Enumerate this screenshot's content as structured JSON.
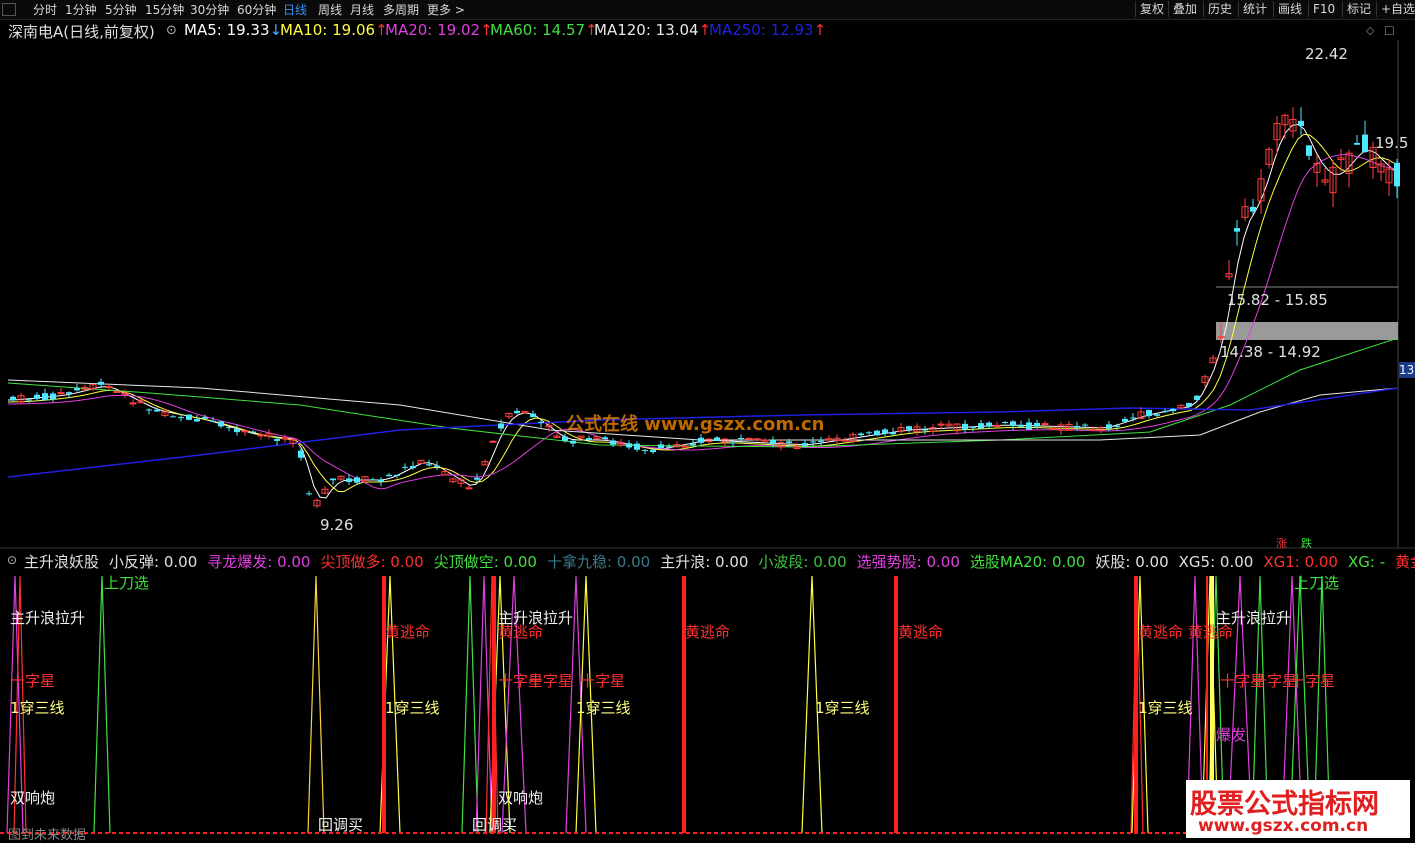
{
  "toolbar": {
    "timeframes": [
      "分时",
      "1分钟",
      "5分钟",
      "15分钟",
      "30分钟",
      "60分钟",
      "日线",
      "周线",
      "月线",
      "多周期",
      "更多 >"
    ],
    "active": "日线",
    "right_buttons": [
      "复权",
      "叠加",
      "历史",
      "统计",
      "画线",
      "F10",
      "标记",
      "+自选"
    ]
  },
  "main": {
    "title": "深南电A(日线,前复权)",
    "ma": [
      {
        "label": "MA5: 19.33",
        "arrow": "↓",
        "color": "#ffffff"
      },
      {
        "label": "MA10: 19.06",
        "arrow": "↑",
        "color": "#ffff40"
      },
      {
        "label": "MA20: 19.02",
        "arrow": "↑",
        "color": "#e040e0"
      },
      {
        "label": "MA60: 14.57",
        "arrow": "↑",
        "color": "#40e040"
      },
      {
        "label": "MA120: 13.04",
        "arrow": "↑",
        "color": "#e8e8e8"
      },
      {
        "label": "MA250: 12.93",
        "arrow": "↑",
        "color": "#2020e0"
      }
    ],
    "price_high": "22.42",
    "price_low": "9.26",
    "zone_upper": "15.82 - 15.85",
    "zone_lower": "14.38 - 14.92",
    "right_tick": "19.5",
    "right_label": "13",
    "badge_up": "涨",
    "badge_down": "跌"
  },
  "indicator": {
    "items": [
      {
        "text": "主升浪妖股",
        "color": "#e0e0e0"
      },
      {
        "text": "小反弹: 0.00",
        "color": "#e0e0e0"
      },
      {
        "text": "寻龙爆发: 0.00",
        "color": "#e040e0"
      },
      {
        "text": "尖顶做多: 0.00",
        "color": "#ff3030"
      },
      {
        "text": "尖顶做空: 0.00",
        "color": "#40e040"
      },
      {
        "text": "十拿九稳: 0.00",
        "color": "#3a7a8a"
      },
      {
        "text": "主升浪: 0.00",
        "color": "#e0e0e0"
      },
      {
        "text": "小波段: 0.00",
        "color": "#40c040"
      },
      {
        "text": "选强势股: 0.00",
        "color": "#e040e0"
      },
      {
        "text": "选股MA20: 0.00",
        "color": "#40e040"
      },
      {
        "text": "妖股: 0.00",
        "color": "#e0e0e0"
      },
      {
        "text": "XG5: 0.00",
        "color": "#e0e0e0"
      },
      {
        "text": "XG1: 0.00",
        "color": "#ff3030"
      },
      {
        "text": "XG: -",
        "color": "#40e040"
      },
      {
        "text": "黄金柱",
        "color": "#ff3030"
      }
    ],
    "labels": {
      "knife": "上刀选",
      "main_rise": "主升浪拉升",
      "escape": "黄逃命",
      "cross": "十字星",
      "three": "1穿三线",
      "double": "双响炮",
      "pullback": "回调买",
      "burst": "爆发",
      "bottom": "图到未来数据"
    }
  },
  "watermark": {
    "center": "公式在线 www.gszx.com.cn",
    "corner_line1": "股票公式指标网",
    "corner_line2": "www.gszx.com.cn"
  }
}
